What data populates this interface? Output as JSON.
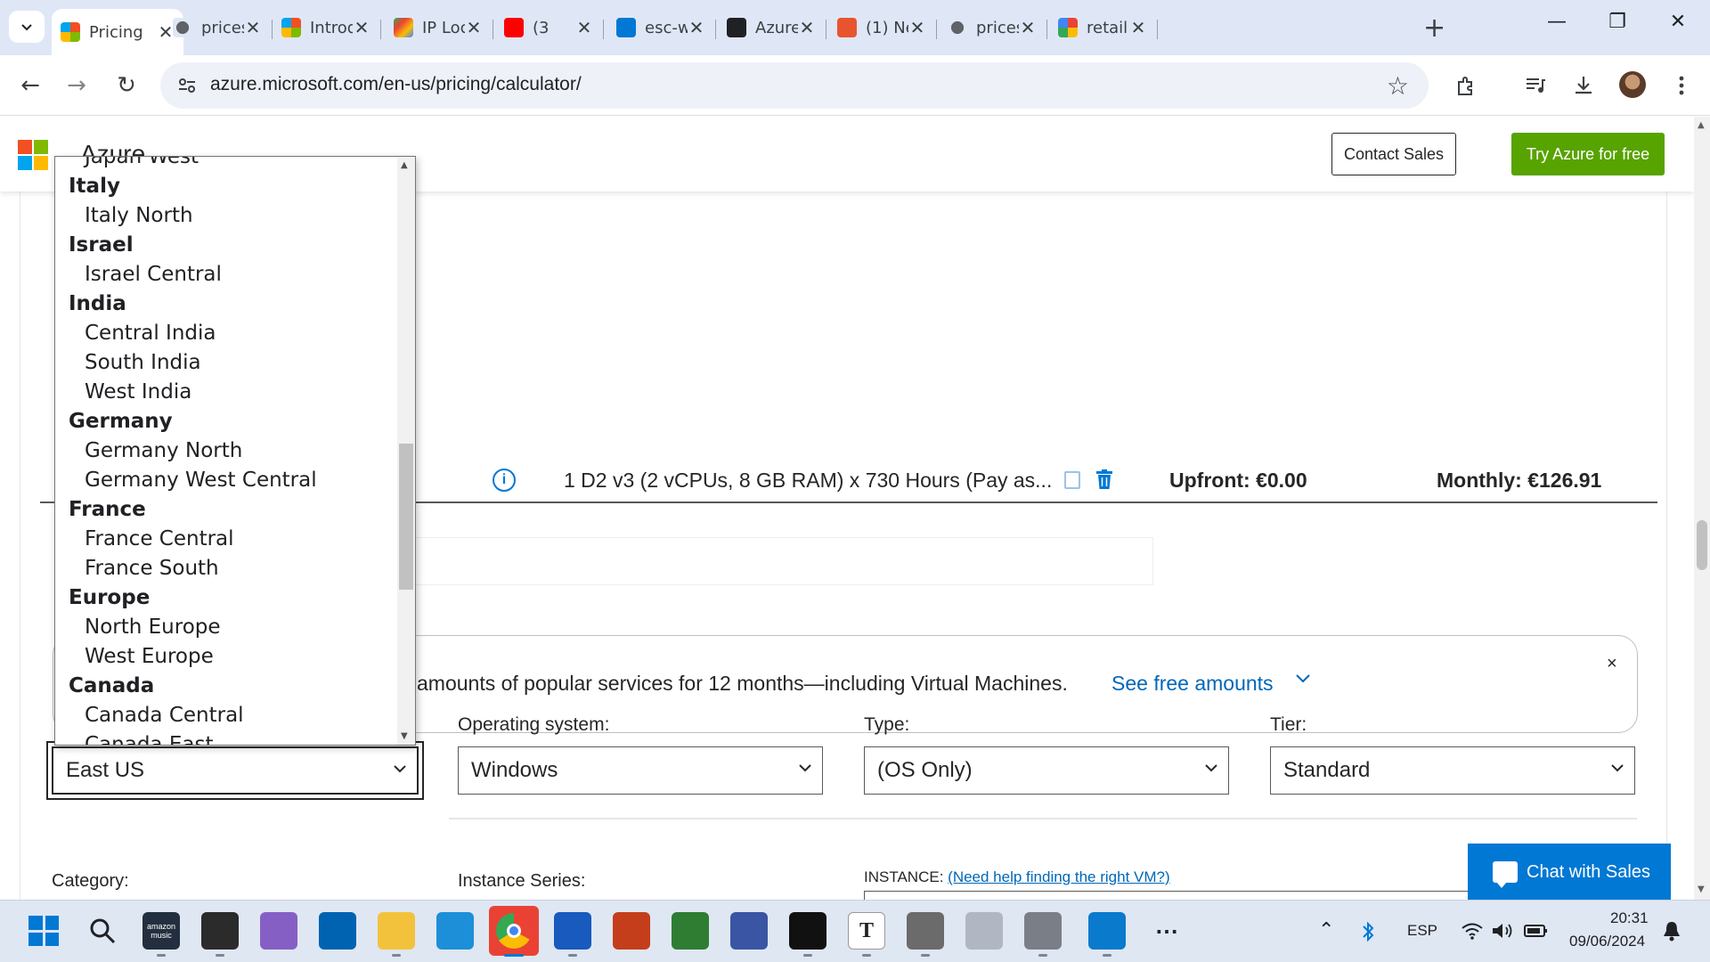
{
  "browser": {
    "tabs": [
      {
        "label": "Pricing",
        "icon": "microsoft-icon",
        "active": true
      },
      {
        "label": "prices",
        "icon": "globe-icon"
      },
      {
        "label": "Introd",
        "icon": "microsoft-icon"
      },
      {
        "label": "IP Loc",
        "icon": "map-pin-icon"
      },
      {
        "label": "(3",
        "icon": "youtube-icon"
      },
      {
        "label": "esc-w",
        "icon": "azure-devops-icon"
      },
      {
        "label": "Azure",
        "icon": "angular-icon"
      },
      {
        "label": "(1) Ne",
        "icon": "red-cloud-icon"
      },
      {
        "label": "prices",
        "icon": "globe-icon"
      },
      {
        "label": "retail",
        "icon": "google-icon"
      }
    ],
    "url": "azure.microsoft.com/en-us/pricing/calculator/"
  },
  "header": {
    "brand": "Azure",
    "contact_sales": "Contact Sales",
    "try_free": "Try Azure for free"
  },
  "estimate_row": {
    "description": "1 D2 v3 (2 vCPUs, 8 GB RAM) x 730 Hours (Pay as...",
    "upfront": "Upfront: €0.00",
    "monthly": "Monthly: €126.91"
  },
  "banner": {
    "text": "amounts of popular services for 12 months—including Virtual Machines.",
    "link": "See free amounts",
    "close": "×"
  },
  "fields": {
    "region": {
      "value": "East US"
    },
    "os": {
      "label": "Operating system:",
      "value": "Windows"
    },
    "type": {
      "label": "Type:",
      "value": "(OS Only)"
    },
    "tier": {
      "label": "Tier:",
      "value": "Standard"
    }
  },
  "lower": {
    "category": "Category:",
    "instance_series": "Instance Series:",
    "instance_prefix": "INSTANCE:",
    "instance_link": "(Need help finding the right VM?)"
  },
  "chat": {
    "label": "Chat with Sales"
  },
  "region_dropdown": {
    "items": [
      {
        "text": "Japan West",
        "group": false
      },
      {
        "text": "Italy",
        "group": true
      },
      {
        "text": "Italy North",
        "group": false
      },
      {
        "text": "Israel",
        "group": true
      },
      {
        "text": "Israel Central",
        "group": false
      },
      {
        "text": "India",
        "group": true
      },
      {
        "text": "Central India",
        "group": false
      },
      {
        "text": "South India",
        "group": false
      },
      {
        "text": "West India",
        "group": false
      },
      {
        "text": "Germany",
        "group": true
      },
      {
        "text": "Germany North",
        "group": false
      },
      {
        "text": "Germany West Central",
        "group": false
      },
      {
        "text": "France",
        "group": true
      },
      {
        "text": "France Central",
        "group": false
      },
      {
        "text": "France South",
        "group": false
      },
      {
        "text": "Europe",
        "group": true
      },
      {
        "text": "North Europe",
        "group": false
      },
      {
        "text": "West Europe",
        "group": false
      },
      {
        "text": "Canada",
        "group": true
      },
      {
        "text": "Canada Central",
        "group": false
      },
      {
        "text": "Canada East",
        "group": false
      }
    ]
  },
  "taskbar": {
    "language": "ESP",
    "time": "20:31",
    "date": "09/06/2024",
    "apps": [
      "windows-start-icon",
      "search-icon",
      "amazon-music-icon",
      "terminal-icon",
      "visual-studio-icon",
      "store-icon",
      "file-explorer-icon",
      "edge-icon",
      "chrome-icon",
      "word-icon",
      "powerpoint-icon",
      "project-icon",
      "visio-icon",
      "webex-icon",
      "typora-icon",
      "settings-icon",
      "snipping-icon",
      "calculator-icon",
      "vscode-icon",
      "more-icon"
    ],
    "amazon_label": "amazon music"
  }
}
